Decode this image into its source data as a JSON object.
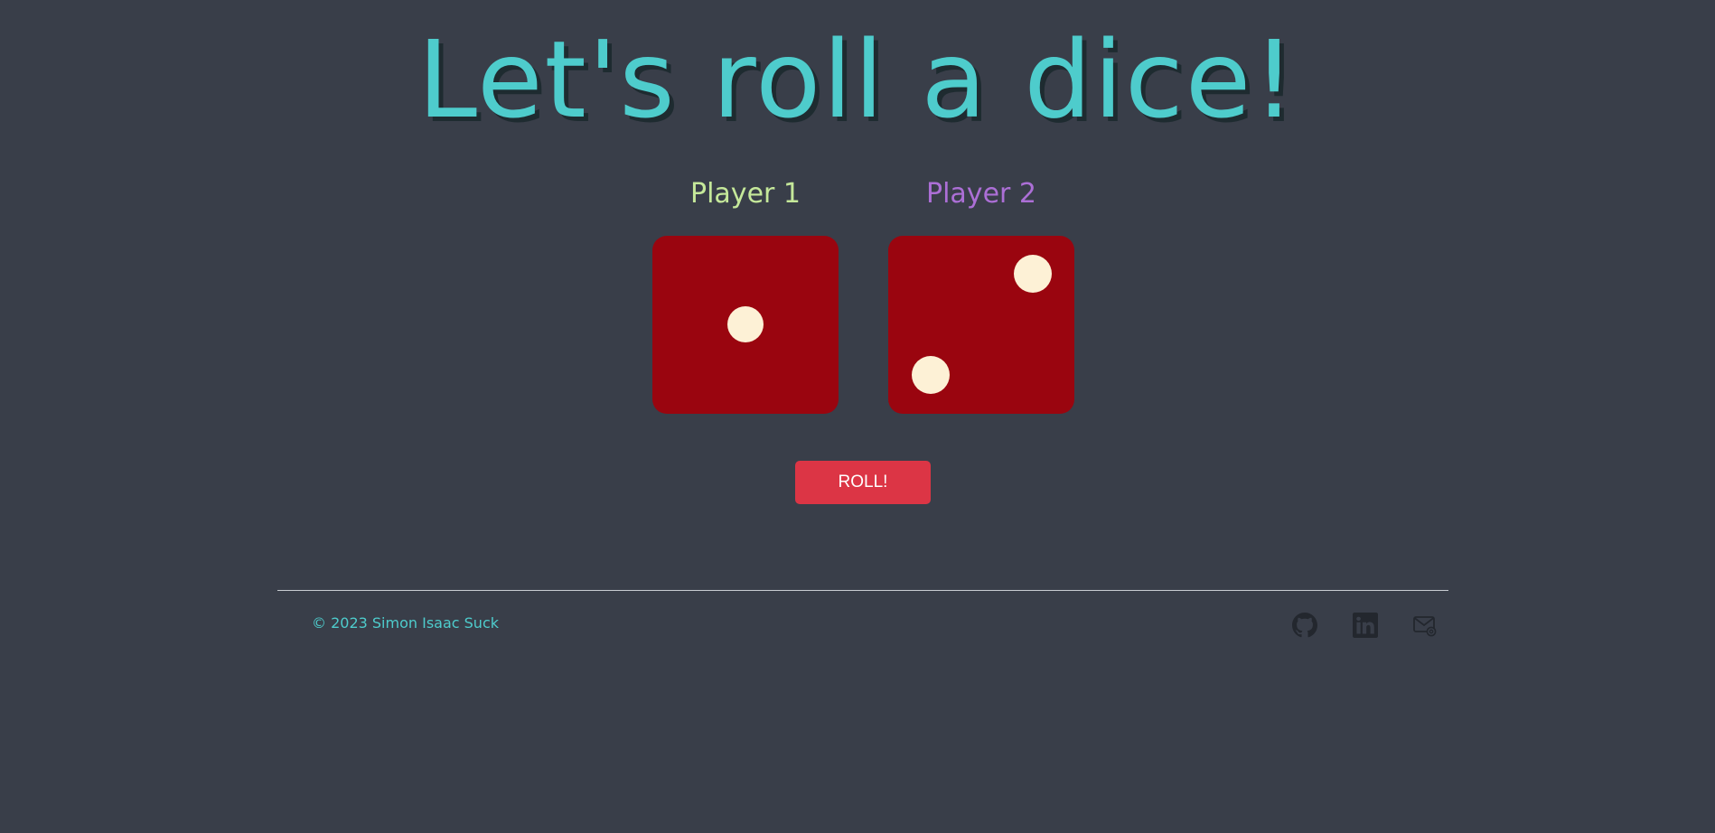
{
  "header": {
    "title": "Let's roll a dice!"
  },
  "players": [
    {
      "label": "Player 1",
      "die_value": 1,
      "color": "#c5e89a"
    },
    {
      "label": "Player 2",
      "die_value": 2,
      "color": "#ac6fd6"
    }
  ],
  "dice_colors": {
    "face": "#9a050f",
    "pip": "#fdf1d6"
  },
  "roll_button": {
    "label": "ROLL!",
    "color": "#dc3545"
  },
  "footer": {
    "copyright": "© 2023 Simon Isaac Suck",
    "text_color": "#4ecccc",
    "icon_color": "#23272e",
    "social_icons": [
      "github-icon",
      "linkedin-icon",
      "email-icon"
    ]
  }
}
